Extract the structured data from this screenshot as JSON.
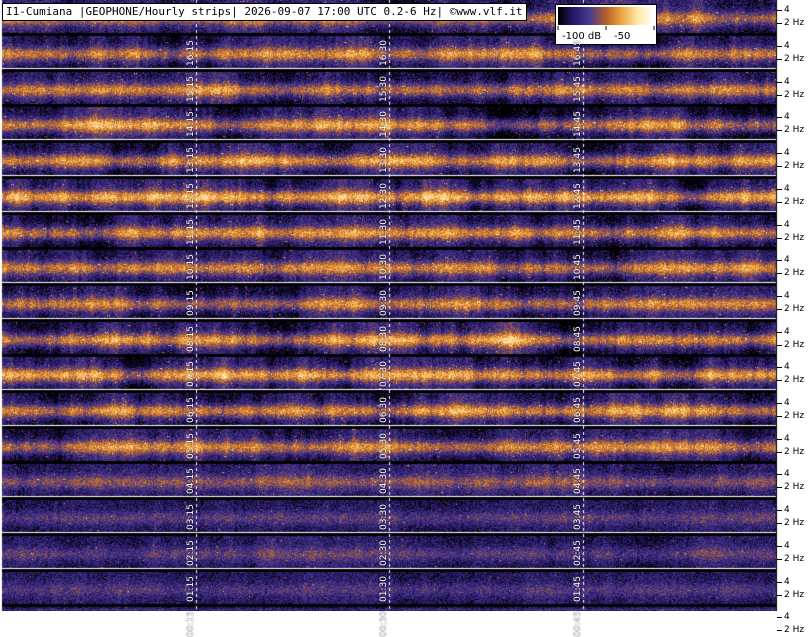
{
  "title": "I1-Cumiana |GEOPHONE/Hourly strips| 2026-09-07 17:00 UTC 0.2-6 Hz| ©www.vlf.it",
  "colorbar": {
    "min_label": "-100 dB",
    "max_label": "-50",
    "colors": [
      "#000000",
      "#2a1a6e",
      "#4b3c8f",
      "#b5602a",
      "#f0a640",
      "#ffe9a8",
      "#ffffff"
    ]
  },
  "chart_data": {
    "type": "heatmap",
    "title": "I1-Cumiana |GEOPHONE/Hourly strips| 2026-09-07 17:00 UTC 0.2-6 Hz| ©www.vlf.it",
    "ylabel": "Hz",
    "yticks": [
      "4",
      "2 Hz"
    ],
    "color_scale_db": [
      -100,
      -50
    ],
    "strips": [
      {
        "hour": "16",
        "ticks": [
          "16:15",
          "16:30",
          "16:45"
        ],
        "intensity": 0.55
      },
      {
        "hour": "15",
        "ticks": [
          "15:15",
          "15:30",
          "15:45"
        ],
        "intensity": 0.55
      },
      {
        "hour": "14",
        "ticks": [
          "14:15",
          "14:30",
          "14:45"
        ],
        "intensity": 0.6
      },
      {
        "hour": "13",
        "ticks": [
          "13:15",
          "13:30",
          "13:45"
        ],
        "intensity": 0.6
      },
      {
        "hour": "12",
        "ticks": [
          "12:15",
          "12:30",
          "12:45"
        ],
        "intensity": 0.65
      },
      {
        "hour": "11",
        "ticks": [
          "11:15",
          "11:30",
          "11:45"
        ],
        "intensity": 0.6
      },
      {
        "hour": "10",
        "ticks": [
          "10:15",
          "10:30",
          "10:45"
        ],
        "intensity": 0.55
      },
      {
        "hour": "09",
        "ticks": [
          "09:15",
          "09:30",
          "09:45"
        ],
        "intensity": 0.55
      },
      {
        "hour": "08",
        "ticks": [
          "08:15",
          "08:30",
          "08:45"
        ],
        "intensity": 0.6
      },
      {
        "hour": "07",
        "ticks": [
          "07:15",
          "07:30",
          "07:45"
        ],
        "intensity": 0.65
      },
      {
        "hour": "06",
        "ticks": [
          "06:15",
          "06:30",
          "06:45"
        ],
        "intensity": 0.6
      },
      {
        "hour": "05",
        "ticks": [
          "05:15",
          "05:30",
          "05:45"
        ],
        "intensity": 0.55
      },
      {
        "hour": "04",
        "ticks": [
          "04:15",
          "04:30",
          "04:45"
        ],
        "intensity": 0.35
      },
      {
        "hour": "03",
        "ticks": [
          "03:15",
          "03:30",
          "03:45"
        ],
        "intensity": 0.25
      },
      {
        "hour": "02",
        "ticks": [
          "02:15",
          "02:30",
          "02:45"
        ],
        "intensity": 0.25
      },
      {
        "hour": "01",
        "ticks": [
          "01:15",
          "01:30",
          "01:45"
        ],
        "intensity": 0.2
      },
      {
        "hour": "00",
        "ticks": [
          "00:15",
          "00:30",
          "00:45"
        ],
        "intensity": 0.15
      }
    ]
  }
}
